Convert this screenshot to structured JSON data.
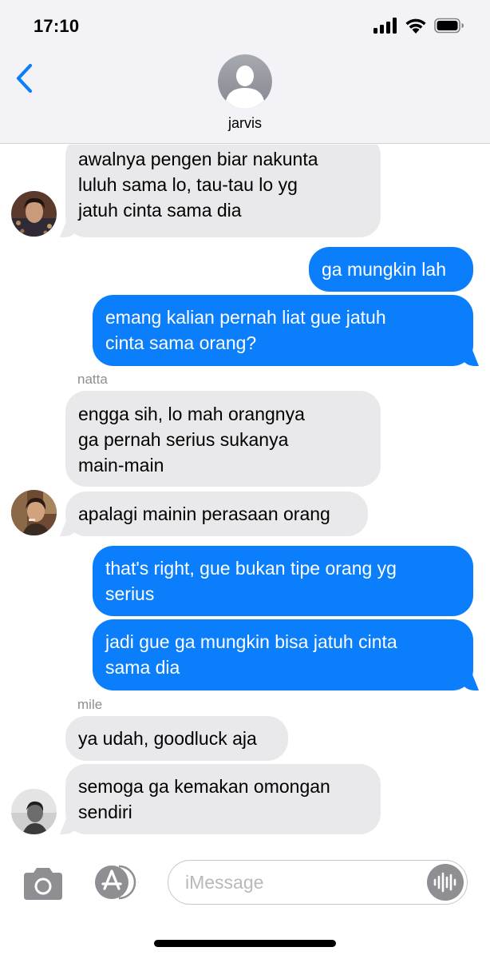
{
  "status_bar": {
    "time": "17:10",
    "icons": [
      "cellular-signal-icon",
      "wifi-icon",
      "battery-icon"
    ]
  },
  "header": {
    "back_icon": "chevron-left-icon",
    "contact_name": "jarvis",
    "accent_color": "#0b7efc"
  },
  "messages": [
    {
      "side": "incoming",
      "text": "awalnya pengen biar nakunta\nluluh sama lo, tau-tau lo yg\njatuh cinta sama dia"
    },
    {
      "side": "outgoing",
      "text": "ga mungkin lah"
    },
    {
      "side": "outgoing",
      "text": "emang kalian pernah liat gue jatuh\ncinta sama orang?"
    },
    {
      "side": "incoming",
      "sender": "natta",
      "text": "engga sih, lo mah orangnya\nga pernah serius sukanya\nmain-main"
    },
    {
      "side": "incoming",
      "text": "apalagi mainin perasaan orang"
    },
    {
      "side": "outgoing",
      "text": "that's right, gue bukan tipe orang yg\nserius"
    },
    {
      "side": "outgoing",
      "text": "jadi gue ga mungkin bisa jatuh cinta\nsama dia"
    },
    {
      "side": "incoming",
      "sender": "mile",
      "text": "ya udah, goodluck aja"
    },
    {
      "side": "incoming",
      "text": "semoga ga kemakan omongan\nsendiri"
    }
  ],
  "input_bar": {
    "placeholder": "iMessage",
    "icons": [
      "camera-icon",
      "app-store-icon",
      "audio-waveform-icon"
    ]
  },
  "colors": {
    "outgoing_bubble": "#0b7efc",
    "incoming_bubble": "#e9e9eb",
    "header_background": "#f2f2f7"
  }
}
